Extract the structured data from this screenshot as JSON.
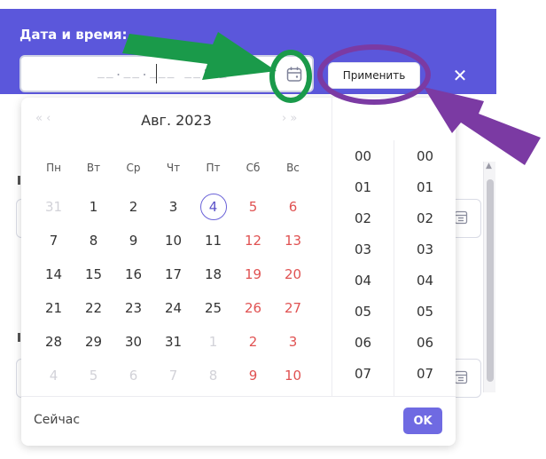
{
  "header": {
    "title": "Дата и время:",
    "datetime_mask": "__.__.___ __:__",
    "apply_label": "Применить",
    "close_glyph": "✕",
    "calendar_icon": "calendar-icon",
    "accent_color": "#5b57db"
  },
  "calendar": {
    "prev_nav": "«  ‹",
    "next_nav": "›  »",
    "month": "Авг. 2023",
    "weekdays": [
      "Пн",
      "Вт",
      "Ср",
      "Чт",
      "Пт",
      "Сб",
      "Вс"
    ],
    "weeks": [
      [
        {
          "d": "31",
          "k": "muted"
        },
        {
          "d": "1",
          "k": ""
        },
        {
          "d": "2",
          "k": ""
        },
        {
          "d": "3",
          "k": ""
        },
        {
          "d": "4",
          "k": "today"
        },
        {
          "d": "5",
          "k": "weekend"
        },
        {
          "d": "6",
          "k": "weekend"
        }
      ],
      [
        {
          "d": "7",
          "k": ""
        },
        {
          "d": "8",
          "k": ""
        },
        {
          "d": "9",
          "k": ""
        },
        {
          "d": "10",
          "k": ""
        },
        {
          "d": "11",
          "k": ""
        },
        {
          "d": "12",
          "k": "weekend"
        },
        {
          "d": "13",
          "k": "weekend"
        }
      ],
      [
        {
          "d": "14",
          "k": ""
        },
        {
          "d": "15",
          "k": ""
        },
        {
          "d": "16",
          "k": ""
        },
        {
          "d": "17",
          "k": ""
        },
        {
          "d": "18",
          "k": ""
        },
        {
          "d": "19",
          "k": "weekend"
        },
        {
          "d": "20",
          "k": "weekend"
        }
      ],
      [
        {
          "d": "21",
          "k": ""
        },
        {
          "d": "22",
          "k": ""
        },
        {
          "d": "23",
          "k": ""
        },
        {
          "d": "24",
          "k": ""
        },
        {
          "d": "25",
          "k": ""
        },
        {
          "d": "26",
          "k": "weekend"
        },
        {
          "d": "27",
          "k": "weekend"
        }
      ],
      [
        {
          "d": "28",
          "k": ""
        },
        {
          "d": "29",
          "k": ""
        },
        {
          "d": "30",
          "k": ""
        },
        {
          "d": "31",
          "k": ""
        },
        {
          "d": "1",
          "k": "muted"
        },
        {
          "d": "2",
          "k": "weekend"
        },
        {
          "d": "3",
          "k": "weekend"
        }
      ],
      [
        {
          "d": "4",
          "k": "muted"
        },
        {
          "d": "5",
          "k": "muted"
        },
        {
          "d": "6",
          "k": "muted"
        },
        {
          "d": "7",
          "k": "muted"
        },
        {
          "d": "8",
          "k": "muted"
        },
        {
          "d": "9",
          "k": "weekend"
        },
        {
          "d": "10",
          "k": "weekend"
        }
      ]
    ],
    "today_color": "#6b63d8",
    "weekend_color": "#e05252"
  },
  "time": {
    "hours": [
      "00",
      "01",
      "02",
      "03",
      "04",
      "05",
      "06",
      "07"
    ],
    "minutes": [
      "00",
      "01",
      "02",
      "03",
      "04",
      "05",
      "06",
      "07"
    ]
  },
  "footer": {
    "now_label": "Сейчас",
    "ok_label": "OK",
    "ok_color": "#6f6ae2"
  },
  "annotations": {
    "arrow_green_color": "#1a9a4a",
    "arrow_purple_color": "#7b3aa3"
  }
}
